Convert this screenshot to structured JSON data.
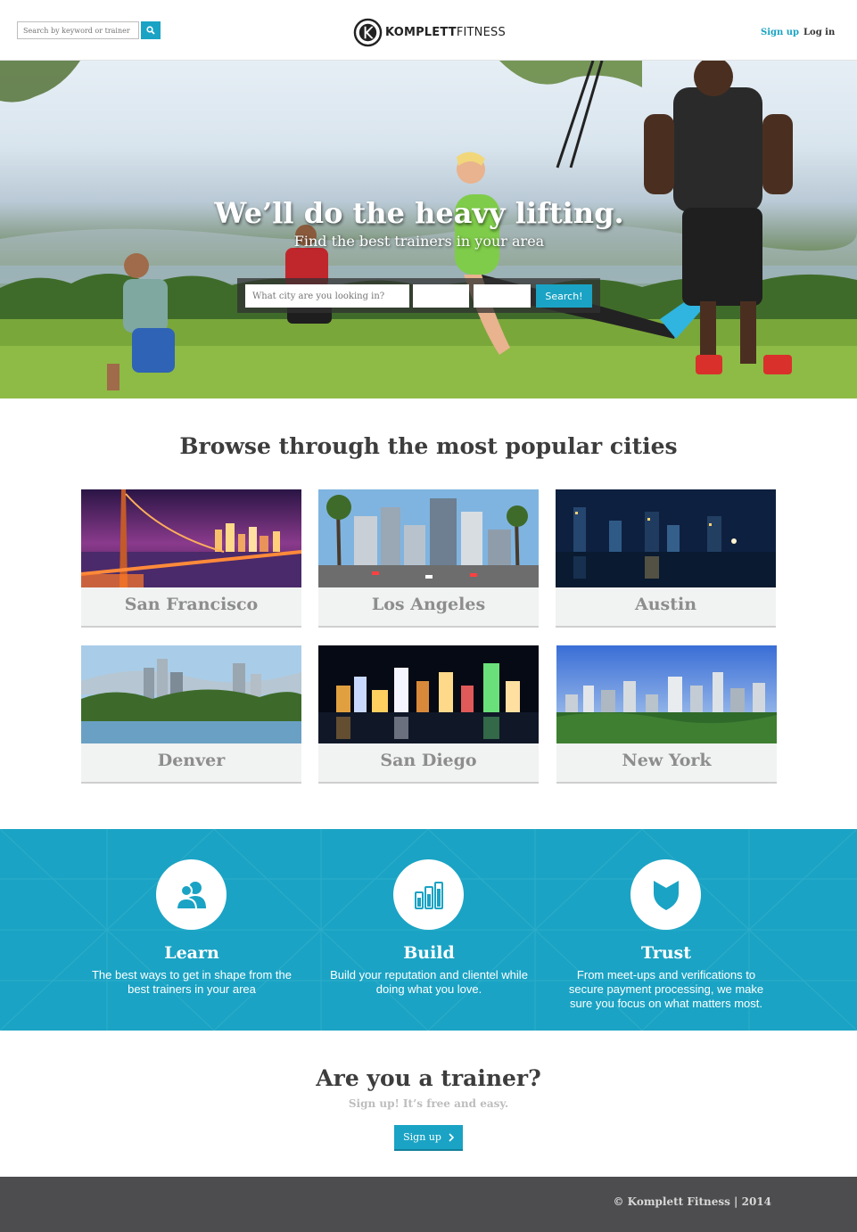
{
  "header": {
    "search_placeholder": "Search by keyword or trainer",
    "logo_bold": "KOMPLETT",
    "logo_light": "FITNESS",
    "signup_label": "Sign up",
    "login_label": "Log in"
  },
  "hero": {
    "title": "We’ll do the heavy lifting.",
    "subtitle": "Find the best trainers in your area",
    "city_placeholder": "What city are you looking in?",
    "search_button": "Search!"
  },
  "cities": {
    "title": "Browse through the most popular cities",
    "items": [
      {
        "name": "San Francisco",
        "icon": "golden-gate-night-photo"
      },
      {
        "name": "Los Angeles",
        "icon": "downtown-palms-photo"
      },
      {
        "name": "Austin",
        "icon": "skyline-night-lake-photo"
      },
      {
        "name": "Denver",
        "icon": "skyline-park-lake-photo"
      },
      {
        "name": "San Diego",
        "icon": "harbor-night-photo"
      },
      {
        "name": "New York",
        "icon": "central-park-skyline-photo"
      }
    ]
  },
  "features": {
    "items": [
      {
        "title": "Learn",
        "text": "The best ways to get in shape from the best trainers in your area",
        "icon": "users-icon"
      },
      {
        "title": "Build",
        "text": "Build your reputation and clientel while doing what you love.",
        "icon": "bar-chart-icon"
      },
      {
        "title": "Trust",
        "text": "From meet-ups and verifications to secure payment processing, we make sure you focus on what matters most.",
        "icon": "shield-icon"
      }
    ],
    "colors": {
      "background": "#1aa3c4"
    }
  },
  "cta": {
    "title": "Are you a trainer?",
    "subtitle": "Sign up! It’s free and easy.",
    "button": "Sign up"
  },
  "footer": {
    "copyright": "© Komplett Fitness | 2014"
  },
  "colors": {
    "accent": "#1aa3c4",
    "footer": "#4d4d4f"
  }
}
